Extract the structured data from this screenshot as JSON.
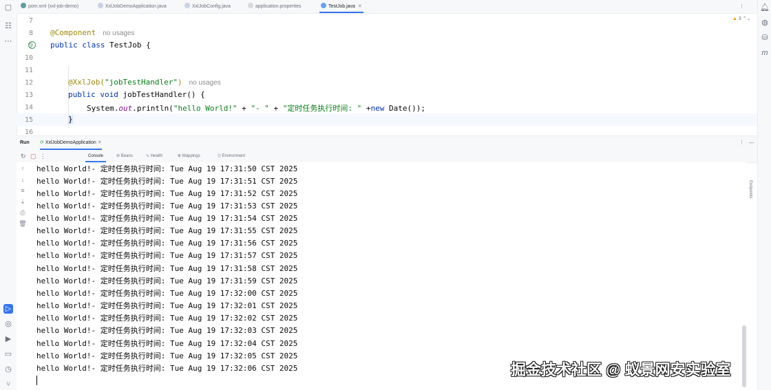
{
  "tabs": [
    {
      "label": "pom.xml (xxl-job-demo)",
      "color": "#5f9ea0",
      "active": false
    },
    {
      "label": "XxlJobDemoApplication.java",
      "color": "#c9d3e6",
      "active": false
    },
    {
      "label": "XxlJobConfig.java",
      "color": "#c9d3e6",
      "active": false
    },
    {
      "label": "application.properties",
      "color": "#d9d9d9",
      "active": false
    },
    {
      "label": "TestJob.java",
      "color": "#6aa0f5",
      "active": true
    }
  ],
  "editor": {
    "warnings_badge": "3",
    "lines": [
      {
        "num": "7"
      },
      {
        "num": "8",
        "annotation": "@Component",
        "hint": "no usages"
      },
      {
        "num": "9",
        "kw": "public class",
        "rest": " TestJob {"
      },
      {
        "num": "10"
      },
      {
        "num": "11"
      },
      {
        "num": "12",
        "annotation": "@XxlJob(",
        "string": "\"jobTestHandler\"",
        "after": ")",
        "hint": "no usages"
      },
      {
        "num": "13",
        "kw": "public void",
        "rest": " jobTestHandler() {"
      },
      {
        "num": "14",
        "p1": "System.",
        "field": "out",
        "p2": ".println(",
        "s1": "\"hello World!\"",
        "p3": " + ",
        "s2": "\"- \"",
        "p4": " + ",
        "s3": "\"定时任务执行时间: \"",
        "p5": " +",
        "kw": "new",
        "p6": " Date());"
      },
      {
        "num": "15",
        "rest": "}"
      },
      {
        "num": "16"
      }
    ]
  },
  "run_panel": {
    "title": "Run",
    "config": "XxlJobDemoApplication",
    "tabs": [
      "Console",
      "Beans",
      "Health",
      "Mappings",
      "Environment"
    ],
    "side_label": "Endpoints"
  },
  "console_lines": [
    "hello World!- 定时任务执行时间: Tue Aug 19 17:31:50 CST 2025",
    "hello World!- 定时任务执行时间: Tue Aug 19 17:31:51 CST 2025",
    "hello World!- 定时任务执行时间: Tue Aug 19 17:31:52 CST 2025",
    "hello World!- 定时任务执行时间: Tue Aug 19 17:31:53 CST 2025",
    "hello World!- 定时任务执行时间: Tue Aug 19 17:31:54 CST 2025",
    "hello World!- 定时任务执行时间: Tue Aug 19 17:31:55 CST 2025",
    "hello World!- 定时任务执行时间: Tue Aug 19 17:31:56 CST 2025",
    "hello World!- 定时任务执行时间: Tue Aug 19 17:31:57 CST 2025",
    "hello World!- 定时任务执行时间: Tue Aug 19 17:31:58 CST 2025",
    "hello World!- 定时任务执行时间: Tue Aug 19 17:31:59 CST 2025",
    "hello World!- 定时任务执行时间: Tue Aug 19 17:32:00 CST 2025",
    "hello World!- 定时任务执行时间: Tue Aug 19 17:32:01 CST 2025",
    "hello World!- 定时任务执行时间: Tue Aug 19 17:32:02 CST 2025",
    "hello World!- 定时任务执行时间: Tue Aug 19 17:32:03 CST 2025",
    "hello World!- 定时任务执行时间: Tue Aug 19 17:32:04 CST 2025",
    "hello World!- 定时任务执行时间: Tue Aug 19 17:32:05 CST 2025",
    "hello World!- 定时任务执行时间: Tue Aug 19 17:32:06 CST 2025"
  ],
  "watermark": "掘金技术社区 @ 蚁景网安实验室",
  "colors": {
    "accent": "#3574f0",
    "keyword": "#0033b3",
    "annotation": "#9e880d",
    "string": "#067d17"
  }
}
